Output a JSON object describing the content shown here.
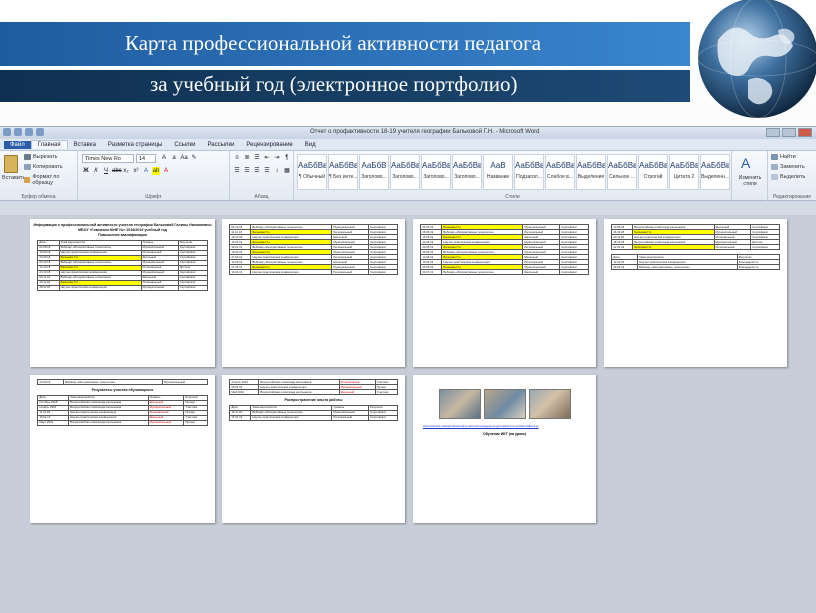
{
  "slide": {
    "title_line1": "Карта профессиональной активности педагога",
    "title_line2": "за учебный год (электронное портфолио)"
  },
  "word": {
    "window_title": "Отчет о профактивности 18-19 учителя географии Бальковой Г.Н. - Microsoft Word",
    "tabs": [
      "Файл",
      "Главная",
      "Вставка",
      "Разметка страницы",
      "Ссылки",
      "Рассылки",
      "Рецензирование",
      "Вид"
    ],
    "active_tab_index": 1,
    "clipboard": {
      "paste": "Вставить",
      "cut": "Вырезать",
      "copy": "Копировать",
      "format_painter": "Формат по образцу",
      "group": "Буфер обмена"
    },
    "font": {
      "name": "Times New Ro",
      "size": "14",
      "group": "Шрифт"
    },
    "paragraph_group": "Абзац",
    "styles_group": "Стили",
    "styles": [
      {
        "sample": "АаБбВвГ",
        "name": "¶ Обычный"
      },
      {
        "sample": "АаБбВвГ",
        "name": "¶ Без инте..."
      },
      {
        "sample": "АаБбВ",
        "name": "Заголово..."
      },
      {
        "sample": "АаБбВв",
        "name": "Заголово..."
      },
      {
        "sample": "АаБбВвГ",
        "name": "Заголово..."
      },
      {
        "sample": "АаБбВвГ",
        "name": "Заголово..."
      },
      {
        "sample": "АаВ",
        "name": "Название"
      },
      {
        "sample": "АаБбВвГ",
        "name": "Подзагол..."
      },
      {
        "sample": "АаБбВвГ",
        "name": "Слабое в..."
      },
      {
        "sample": "АаБбВвГ",
        "name": "Выделение"
      },
      {
        "sample": "АаБбВвГ",
        "name": "Сильное ..."
      },
      {
        "sample": "АаБбВвГ",
        "name": "Строгий"
      },
      {
        "sample": "АаБбВвГ",
        "name": "Цитата 2"
      },
      {
        "sample": "АаБбВвГ",
        "name": "Выделенн..."
      }
    ],
    "change_styles": "Изменить стили",
    "editing": {
      "find": "Найти",
      "replace": "Заменить",
      "select": "Выделить",
      "group": "Редактирование"
    },
    "document": {
      "page1_heading": "Информация о профессиональной активности учителя географии Бальковой Галины Николаевны МБОУ «Гимназия ЮНЕ №» 2018/2019 учебный год",
      "page1_subheading": "Повышение квалификации",
      "col_date": "Дата",
      "col_event": "Тема мероприятия",
      "col_level": "Уровень",
      "col_result": "Результат",
      "cell_cert": "Сертификат",
      "cell_diploma": "Диплом",
      "cell_gratitude": "Благодарность",
      "cell_participant": "Участник",
      "cell_municipal": "Муниципальный",
      "cell_regional": "Региональный",
      "cell_school": "Школьный",
      "cell_winner": "Призер",
      "cell_name": "Балькова Г.Н.",
      "cell_webinar": "Вебинар «Интерактивные технологии»",
      "cell_olymp": "Всероссийская олимпиада школьников",
      "cell_conf": "Научно-практическая конференция",
      "section_results": "Результаты участия обучающихся",
      "section_pub": "Распространение опыта работы",
      "photo_caption": "Обучение ИКТ (на уроке)",
      "link_text": "https://infourok.ru/kartaprofessionalnoy-aktivnosti-pedagoga-za-god-elektronnoe-portfolio-balkova-gn"
    }
  },
  "colors": {
    "band_top": "#2f74bc",
    "band_bottom": "#1d4a76",
    "ribbon_bg": "#e3eaf3",
    "doc_bg": "#c7ced9",
    "highlight": "#ffff00"
  }
}
